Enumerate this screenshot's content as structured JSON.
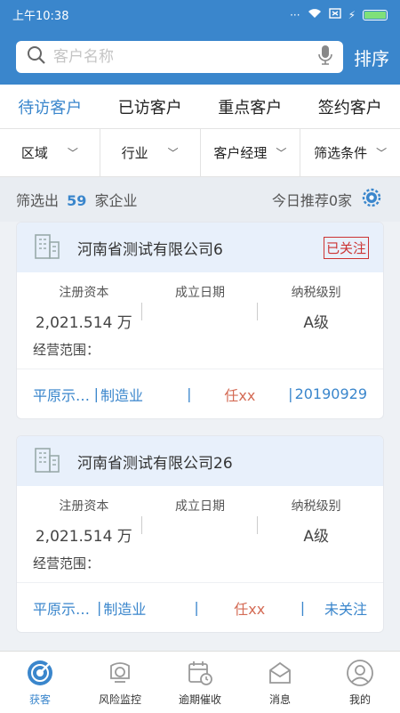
{
  "status": {
    "time": "上午10:38"
  },
  "search": {
    "placeholder": "客户名称",
    "sort_label": "排序"
  },
  "tabs": [
    {
      "label": "待访客户",
      "active": true
    },
    {
      "label": "已访客户"
    },
    {
      "label": "重点客户"
    },
    {
      "label": "签约客户"
    }
  ],
  "filters": [
    {
      "label": "区域"
    },
    {
      "label": "行业"
    },
    {
      "label": "客户经理"
    },
    {
      "label": "筛选条件"
    }
  ],
  "summary": {
    "prefix": "筛选出",
    "count": "59",
    "suffix": "家企业",
    "recommend": "今日推荐0家"
  },
  "stat_labels": {
    "capital": "注册资本",
    "founded": "成立日期",
    "tax": "纳税级别",
    "scope": "经营范围："
  },
  "cards": [
    {
      "name": "河南省测试有限公司6",
      "follow": "已关注",
      "capital": "2,021.514 万",
      "founded": "",
      "tax": "A级",
      "region": "平原示…",
      "industry": "制造业",
      "manager": "任xx",
      "tail": "20190929"
    },
    {
      "name": "河南省测试有限公司26",
      "follow": "",
      "capital": "2,021.514 万",
      "founded": "",
      "tax": "A级",
      "region": "平原示…",
      "industry": "制造业",
      "manager": "任xx",
      "tail": "未关注"
    }
  ],
  "nav": [
    {
      "label": "获客",
      "icon": "target-icon",
      "active": true
    },
    {
      "label": "风险监控",
      "icon": "camera-icon"
    },
    {
      "label": "逾期催收",
      "icon": "calendar-clock-icon"
    },
    {
      "label": "消息",
      "icon": "message-icon"
    },
    {
      "label": "我的",
      "icon": "user-icon"
    }
  ],
  "colors": {
    "primary": "#3a86cc",
    "danger": "#cc3333",
    "manager": "#d46b55"
  }
}
